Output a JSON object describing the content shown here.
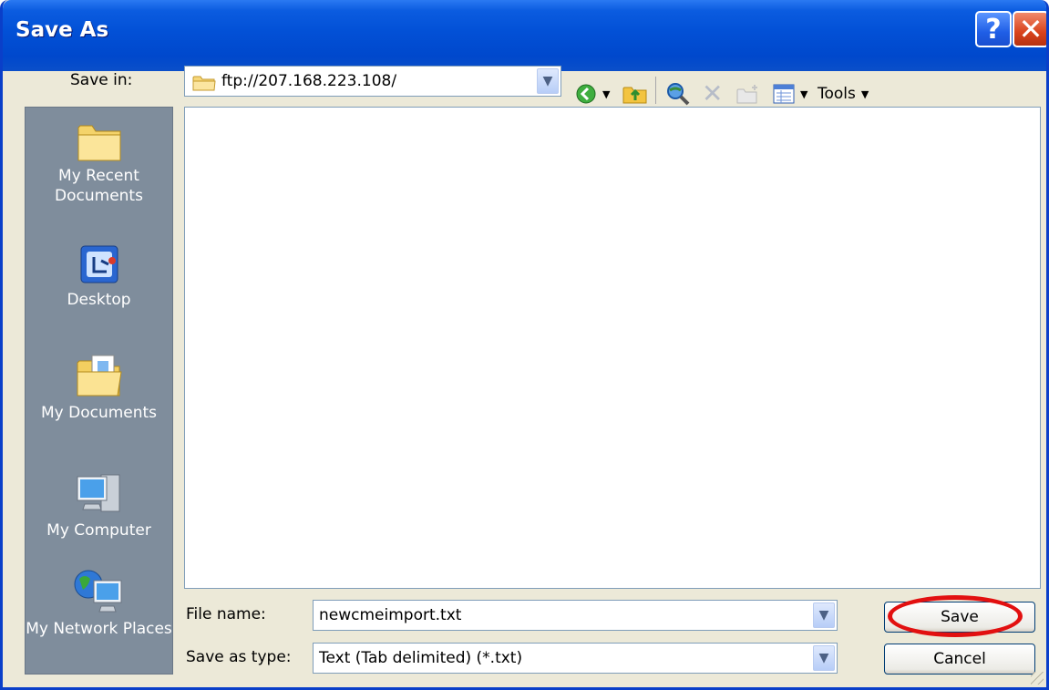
{
  "dialog": {
    "title": "Save As",
    "help_label": "?",
    "close_label": "✕"
  },
  "save_in": {
    "label": "Save in:",
    "value": "ftp://207.168.223.108/"
  },
  "toolbar": {
    "back_icon": "back-arrow-icon",
    "up_icon": "up-folder-icon",
    "search_icon": "search-web-icon",
    "delete_icon": "delete-icon",
    "new_folder_icon": "new-folder-icon",
    "views_icon": "views-icon",
    "tools_label": "Tools"
  },
  "places": [
    {
      "label": "My Recent Documents",
      "icon": "recent-documents-icon"
    },
    {
      "label": "Desktop",
      "icon": "desktop-icon"
    },
    {
      "label": "My Documents",
      "icon": "my-documents-icon"
    },
    {
      "label": "My Computer",
      "icon": "my-computer-icon"
    },
    {
      "label": "My Network Places",
      "icon": "network-places-icon"
    }
  ],
  "file_name": {
    "label": "File name:",
    "value": "newcmeimport.txt"
  },
  "save_as_type": {
    "label": "Save as type:",
    "value": "Text (Tab delimited) (*.txt)"
  },
  "buttons": {
    "save": "Save",
    "cancel": "Cancel"
  },
  "colors": {
    "titlebar": "#0250d6",
    "sidebar": "#7f8d9c",
    "dialog_bg": "#ece9d8",
    "highlight_ring": "#e21010"
  }
}
